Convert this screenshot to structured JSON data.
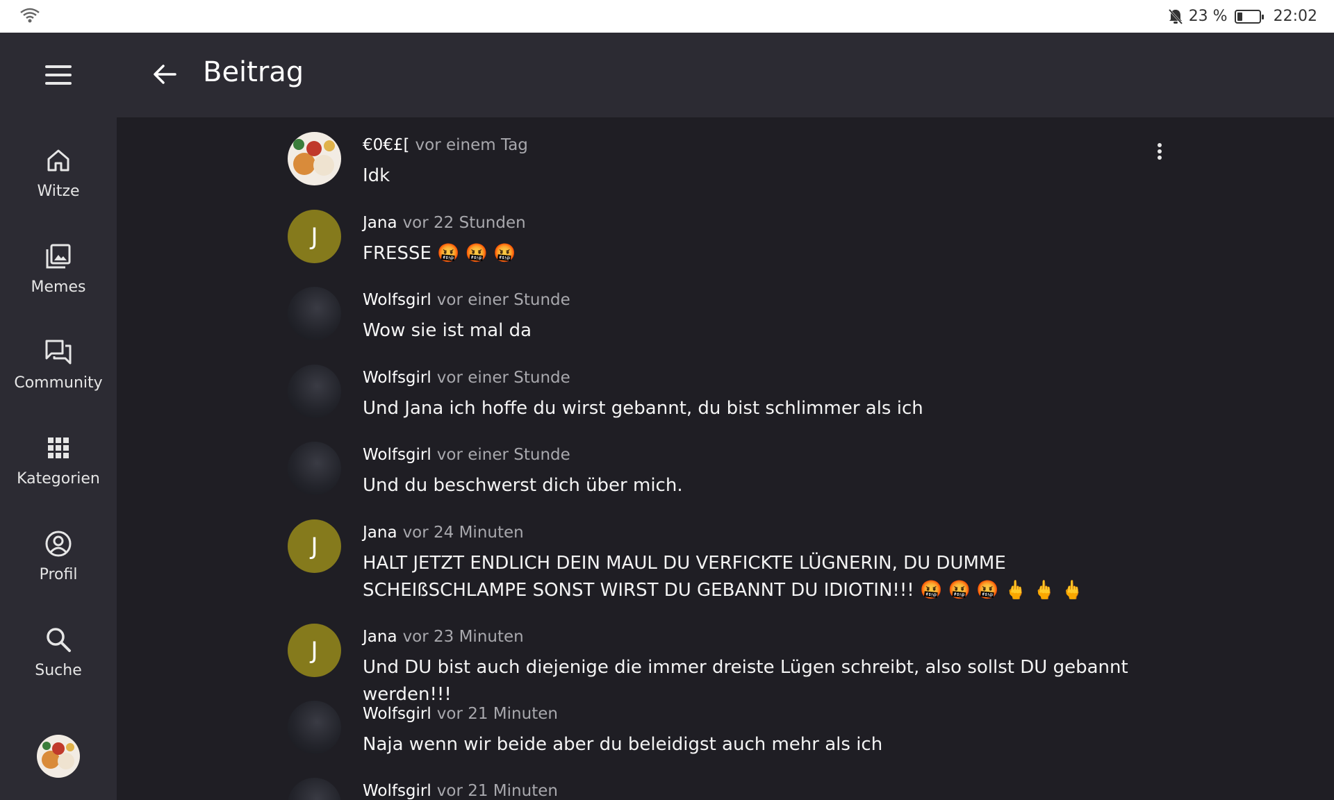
{
  "status": {
    "battery_percent": "23 %",
    "time": "22:02",
    "battery_level": 0.23
  },
  "nav": {
    "items": [
      {
        "label": "Witze",
        "icon": "home-icon"
      },
      {
        "label": "Memes",
        "icon": "gallery-icon"
      },
      {
        "label": "Community",
        "icon": "forum-icon"
      },
      {
        "label": "Kategorien",
        "icon": "grid-icon"
      },
      {
        "label": "Profil",
        "icon": "account-icon"
      },
      {
        "label": "Suche",
        "icon": "search-icon"
      }
    ]
  },
  "header": {
    "title": "Beitrag"
  },
  "comments": [
    {
      "author": "€0€£[",
      "time": "vor einem Tag",
      "text": "Idk",
      "avatar": "image"
    },
    {
      "author": "Jana",
      "time": "vor 22 Stunden",
      "text": "FRESSE 🤬 🤬 🤬",
      "avatar": "J"
    },
    {
      "author": "Wolfsgirl",
      "time": "vor einer Stunde",
      "text": "Wow sie ist mal da",
      "avatar": "image"
    },
    {
      "author": "Wolfsgirl",
      "time": "vor einer Stunde",
      "text": "Und Jana ich hoffe du wirst gebannt, du bist schlimmer als ich",
      "avatar": "image"
    },
    {
      "author": "Wolfsgirl",
      "time": "vor einer Stunde",
      "text": "Und du beschwerst dich über mich.",
      "avatar": "image"
    },
    {
      "author": "Jana",
      "time": "vor 24 Minuten",
      "text": "HALT JETZT ENDLICH DEIN MAUL DU VERFICKTE LÜGNERIN, DU DUMME SCHEIßSCHLAMPE SONST WIRST DU GEBANNT DU IDIOTIN!!! 🤬 🤬 🤬 🖕 🖕 🖕",
      "avatar": "J"
    },
    {
      "author": "Jana",
      "time": "vor 23 Minuten",
      "text": "Und DU bist auch diejenige die immer dreiste Lügen schreibt, also sollst DU gebannt werden!!!",
      "avatar": "J"
    },
    {
      "author": "Wolfsgirl",
      "time": "vor 21 Minuten",
      "text": "Naja wenn wir beide aber du beleidigst auch mehr als ich",
      "avatar": "image"
    },
    {
      "author": "Wolfsgirl",
      "time": "vor 21 Minuten",
      "text": "",
      "avatar": "image"
    }
  ],
  "colors": {
    "background": "#1f1e24",
    "surface": "#2c2b33",
    "avatar_letter_bg": "#857a1c"
  }
}
